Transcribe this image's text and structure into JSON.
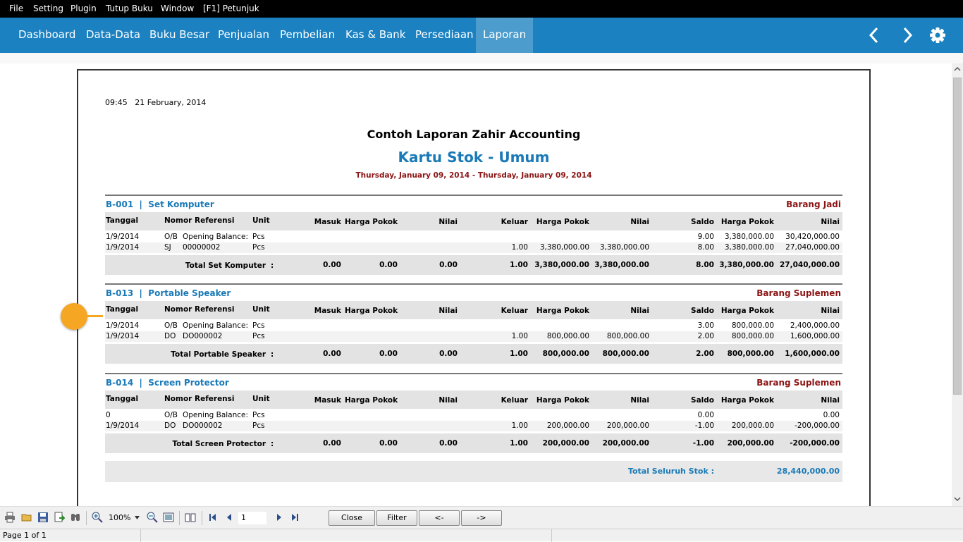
{
  "menu": [
    "File",
    "Setting",
    "Plugin",
    "Tutup Buku",
    "Window",
    "[F1] Petunjuk"
  ],
  "nav": {
    "items": [
      "Dashboard",
      "Data-Data",
      "Buku Besar",
      "Penjualan",
      "Pembelian",
      "Kas & Bank",
      "Persediaan",
      "Laporan"
    ],
    "active": "Laporan",
    "back_icon": "chevron-left-icon",
    "forward_icon": "chevron-right-icon",
    "settings_icon": "gear-icon"
  },
  "colors": {
    "nav_bg": "#1b81c1",
    "nav_active": "#4c9dcd",
    "title_blue": "#1a7ab7",
    "dark_red": "#8b1414",
    "marker": "#f5a623"
  },
  "report": {
    "time": "09:45",
    "date": "21 February, 2014",
    "company": "Contoh Laporan Zahir Accounting",
    "title": "Kartu Stok - Umum",
    "period": "Thursday, January 09, 2014 - Thursday, January 09, 2014",
    "headers": {
      "tanggal": "Tanggal",
      "nomor": "Nomor Referensi",
      "unit": "Unit",
      "masuk": "Masuk",
      "hp1": "Harga Pokok",
      "nilai1": "Nilai",
      "keluar": "Keluar",
      "hp2": "Harga Pokok",
      "nilai2": "Nilai",
      "saldo": "Saldo",
      "hp3": "Harga Pokok",
      "nilai3": "Nilai"
    },
    "sections": [
      {
        "code": "B-001",
        "sep": "|",
        "name": "Set Komputer",
        "category": "Barang Jadi",
        "rows": [
          {
            "tanggal": "1/9/2014",
            "tipe": "O/B",
            "ref": "Opening Balance:",
            "unit": "Pcs",
            "masuk": "",
            "hp1": "",
            "nilai1": "",
            "keluar": "",
            "hp2": "",
            "nilai2": "",
            "saldo": "9.00",
            "hp3": "3,380,000.00",
            "nilai3": "30,420,000.00"
          },
          {
            "tanggal": "1/9/2014",
            "tipe": "SJ",
            "ref": "00000002",
            "unit": "Pcs",
            "masuk": "",
            "hp1": "",
            "nilai1": "",
            "keluar": "1.00",
            "hp2": "3,380,000.00",
            "nilai2": "3,380,000.00",
            "saldo": "8.00",
            "hp3": "3,380,000.00",
            "nilai3": "27,040,000.00"
          }
        ],
        "total": {
          "label": "Total Set Komputer",
          "colon": ":",
          "masuk": "0.00",
          "hp1": "0.00",
          "nilai1": "0.00",
          "keluar": "1.00",
          "hp2": "3,380,000.00",
          "nilai2": "3,380,000.00",
          "saldo": "8.00",
          "hp3": "3,380,000.00",
          "nilai3": "27,040,000.00"
        }
      },
      {
        "code": "B-013",
        "sep": "|",
        "name": "Portable Speaker",
        "category": "Barang Suplemen",
        "rows": [
          {
            "tanggal": "1/9/2014",
            "tipe": "O/B",
            "ref": "Opening Balance:",
            "unit": "Pcs",
            "masuk": "",
            "hp1": "",
            "nilai1": "",
            "keluar": "",
            "hp2": "",
            "nilai2": "",
            "saldo": "3.00",
            "hp3": "800,000.00",
            "nilai3": "2,400,000.00"
          },
          {
            "tanggal": "1/9/2014",
            "tipe": "DO",
            "ref": "DO000002",
            "unit": "Pcs",
            "masuk": "",
            "hp1": "",
            "nilai1": "",
            "keluar": "1.00",
            "hp2": "800,000.00",
            "nilai2": "800,000.00",
            "saldo": "2.00",
            "hp3": "800,000.00",
            "nilai3": "1,600,000.00"
          }
        ],
        "total": {
          "label": "Total Portable Speaker",
          "colon": ":",
          "masuk": "0.00",
          "hp1": "0.00",
          "nilai1": "0.00",
          "keluar": "1.00",
          "hp2": "800,000.00",
          "nilai2": "800,000.00",
          "saldo": "2.00",
          "hp3": "800,000.00",
          "nilai3": "1,600,000.00"
        }
      },
      {
        "code": "B-014",
        "sep": "|",
        "name": "Screen Protector",
        "category": "Barang Suplemen",
        "rows": [
          {
            "tanggal": "0",
            "tipe": "O/B",
            "ref": "Opening Balance:",
            "unit": "Pcs",
            "masuk": "",
            "hp1": "",
            "nilai1": "",
            "keluar": "",
            "hp2": "",
            "nilai2": "",
            "saldo": "0.00",
            "hp3": "",
            "nilai3": "0.00"
          },
          {
            "tanggal": "1/9/2014",
            "tipe": "DO",
            "ref": "DO000002",
            "unit": "Pcs",
            "masuk": "",
            "hp1": "",
            "nilai1": "",
            "keluar": "1.00",
            "hp2": "200,000.00",
            "nilai2": "200,000.00",
            "saldo": "-1.00",
            "hp3": "200,000.00",
            "nilai3": "-200,000.00"
          }
        ],
        "total": {
          "label": "Total Screen Protector",
          "colon": ":",
          "masuk": "0.00",
          "hp1": "0.00",
          "nilai1": "0.00",
          "keluar": "1.00",
          "hp2": "200,000.00",
          "nilai2": "200,000.00",
          "saldo": "-1.00",
          "hp3": "200,000.00",
          "nilai3": "-200,000.00"
        }
      }
    ],
    "grand_total": {
      "label": "Total Seluruh Stok :",
      "value": "28,440,000.00"
    }
  },
  "toolbar": {
    "icons": [
      "print-icon",
      "open-icon",
      "save-icon",
      "export-icon",
      "find-icon",
      "zoom-in-icon",
      "zoom-out-icon",
      "fit-page-icon",
      "book-icon",
      "first-page-icon",
      "prev-page-icon",
      "next-page-icon",
      "last-page-icon"
    ],
    "zoom": "100%",
    "page": "1",
    "buttons": {
      "close": "Close",
      "filter": "Filter",
      "prev": "<-",
      "next": "->"
    }
  },
  "status": {
    "page": "Page 1 of 1"
  }
}
